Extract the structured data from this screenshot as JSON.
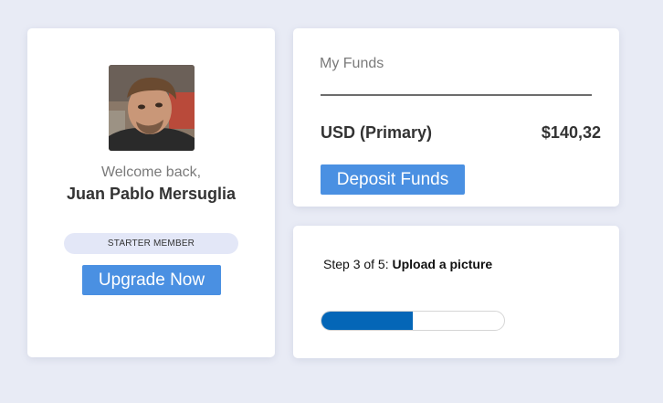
{
  "profile": {
    "welcome_text": "Welcome back,",
    "user_name": "Juan Pablo Mersuglia",
    "membership": "STARTER MEMBER",
    "upgrade_label": "Upgrade Now"
  },
  "funds": {
    "title": "My Funds",
    "currency_label": "USD (Primary)",
    "amount": "$140,32",
    "deposit_label": "Deposit Funds"
  },
  "onboarding": {
    "step_prefix": "Step 3 of 5:",
    "step_task": "Upload a picture",
    "progress_fraction": 0.5
  },
  "colors": {
    "accent": "#4a90e2",
    "progress": "#0466b7",
    "page_background": "#e8ebf5"
  },
  "icons": {
    "avatar": "user-photo"
  }
}
